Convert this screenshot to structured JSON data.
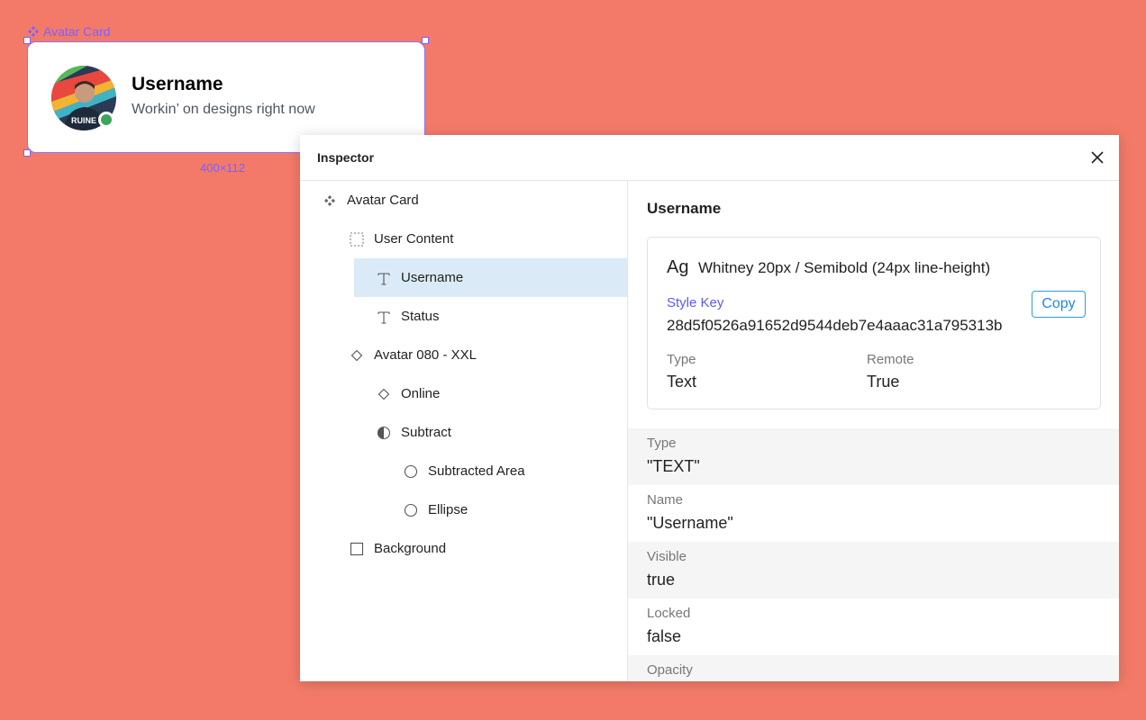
{
  "canvas": {
    "selection_label": "Avatar Card",
    "card": {
      "name": "Username",
      "status": "Workin’ on designs right now",
      "online_color": "#3BA55D"
    },
    "dimensions": "400×112"
  },
  "inspector": {
    "title": "Inspector",
    "tree": [
      {
        "label": "Avatar Card",
        "icon": "component-icon"
      },
      {
        "label": "User Content",
        "icon": "frame-icon"
      },
      {
        "label": "Username",
        "icon": "text-icon",
        "selected": true
      },
      {
        "label": "Status",
        "icon": "text-icon"
      },
      {
        "label": "Avatar 080 - XXL",
        "icon": "instance-icon"
      },
      {
        "label": "Online",
        "icon": "instance-icon"
      },
      {
        "label": "Subtract",
        "icon": "boolean-icon"
      },
      {
        "label": "Subtracted Area",
        "icon": "ellipse-icon"
      },
      {
        "label": "Ellipse",
        "icon": "ellipse-icon"
      },
      {
        "label": "Background",
        "icon": "rectangle-icon"
      }
    ],
    "detail": {
      "title": "Username",
      "style": {
        "ag": "Ag",
        "font": "Whitney 20px / Semibold (24px line-height)",
        "key_label": "Style Key",
        "key": "28d5f0526a91652d9544deb7e4aaac31a795313b",
        "copy_label": "Copy",
        "type_label": "Type",
        "type_value": "Text",
        "remote_label": "Remote",
        "remote_value": "True"
      },
      "properties": [
        {
          "label": "Type",
          "value": "\"TEXT\""
        },
        {
          "label": "Name",
          "value": "\"Username\""
        },
        {
          "label": "Visible",
          "value": "true"
        },
        {
          "label": "Locked",
          "value": "false"
        },
        {
          "label": "Opacity",
          "value": ""
        }
      ]
    }
  }
}
